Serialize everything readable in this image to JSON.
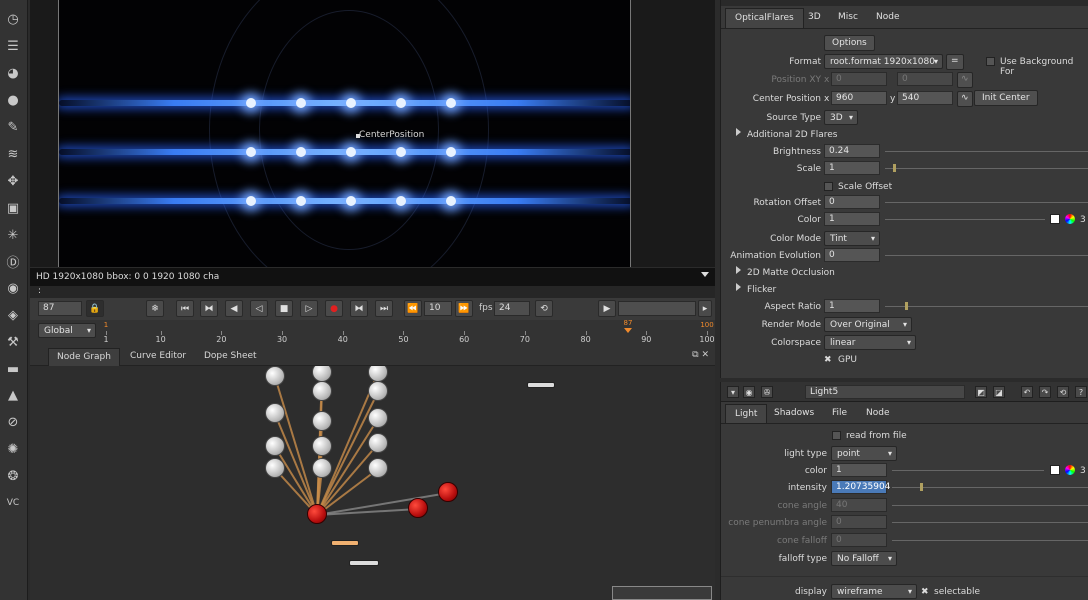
{
  "viewer": {
    "overlay_label": "CenterPosition",
    "info": "HD 1920x1080 bbox: 0 0 1920 1080 cha",
    "strip": ":"
  },
  "transport": {
    "frame": "87",
    "increment": "10",
    "fps_label": "fps",
    "fps": "24"
  },
  "timeline": {
    "range_mode": "Global",
    "ticks": [
      "1",
      "10",
      "20",
      "30",
      "40",
      "50",
      "60",
      "70",
      "80",
      "90",
      "100"
    ],
    "in_marker": "1",
    "current_marker": "87",
    "out_marker": "100"
  },
  "node_tabs": [
    "Node Graph",
    "Curve Editor",
    "Dope Sheet"
  ],
  "optical_flares": {
    "tabs": [
      "OpticalFlares",
      "3D",
      "Misc",
      "Node"
    ],
    "options_btn": "Options",
    "format_label": "Format",
    "format_value": "root.format 1920x1080",
    "format_equals": "=",
    "use_bg_label": "Use Background For",
    "position_xy_label": "Position XY",
    "position_x_label": "x",
    "position_x": "0",
    "position_y": "0",
    "center_label": "Center Position",
    "center_x_label": "x",
    "center_x": "960",
    "center_y_label": "y",
    "center_y": "540",
    "init_center_btn": "Init Center",
    "source_type_label": "Source Type",
    "source_type": "3D",
    "additional_label": "Additional 2D Flares",
    "brightness_label": "Brightness",
    "brightness": "0.24",
    "scale_label": "Scale",
    "scale": "1",
    "scale_offset_label": "Scale Offset",
    "rotation_label": "Rotation Offset",
    "rotation": "0",
    "color_label": "Color",
    "color": "1",
    "color_channels": "3",
    "color_mode_label": "Color Mode",
    "color_mode": "Tint",
    "anim_label": "Animation Evolution",
    "anim": "0",
    "matte_label": "2D Matte Occlusion",
    "flicker_label": "Flicker",
    "aspect_label": "Aspect Ratio",
    "aspect": "1",
    "render_mode_label": "Render Mode",
    "render_mode": "Over Original",
    "colorspace_label": "Colorspace",
    "colorspace": "linear",
    "gpu_label": "GPU"
  },
  "light": {
    "name": "Light5",
    "tabs": [
      "Light",
      "Shadows",
      "File",
      "Node"
    ],
    "read_from_file": "read from file",
    "light_type_label": "light type",
    "light_type": "point",
    "color_label": "color",
    "color": "1",
    "color_channels": "3",
    "intensity_label": "intensity",
    "intensity": "1.20735904",
    "cone_angle_label": "cone angle",
    "cone_angle": "40",
    "cone_penumbra_label": "cone penumbra angle",
    "cone_penumbra": "0",
    "cone_falloff_label": "cone falloff",
    "cone_falloff": "0",
    "falloff_type_label": "falloff type",
    "falloff_type": "No Falloff",
    "display_label": "display",
    "display": "wireframe",
    "selectable_label": "selectable"
  }
}
